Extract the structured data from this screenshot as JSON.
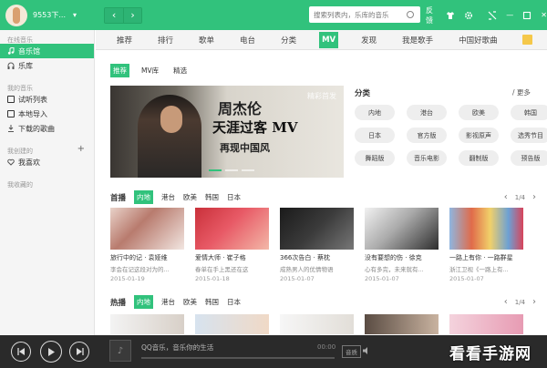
{
  "titlebar": {
    "username": "9553下...",
    "back_label": "‹",
    "forward_label": "›",
    "search_placeholder": "搜索列表内，乐库的音乐",
    "feedback_label": "反馈",
    "minimize_label": "—",
    "close_label": "✕"
  },
  "sidebar": {
    "online_heading": "在线音乐",
    "online_items": [
      {
        "label": "音乐馆"
      },
      {
        "label": "乐库"
      }
    ],
    "mine_heading": "我的音乐",
    "mine_items": [
      {
        "label": "试听列表"
      },
      {
        "label": "本地导入"
      },
      {
        "label": "下载的歌曲"
      }
    ],
    "created_heading": "我创建的",
    "created_add": "+",
    "created_items": [
      {
        "label": "我喜欢"
      }
    ],
    "collected_heading": "我收藏的"
  },
  "topnav": {
    "tabs": [
      {
        "label": "推荐"
      },
      {
        "label": "排行"
      },
      {
        "label": "歌单"
      },
      {
        "label": "电台"
      },
      {
        "label": "分类"
      },
      {
        "label": "MV"
      },
      {
        "label": "发现"
      },
      {
        "label": "我是歌手"
      },
      {
        "label": "中国好歌曲"
      }
    ],
    "active_tab": "MV"
  },
  "subtabs": [
    {
      "label": "推荐"
    },
    {
      "label": "MV库"
    },
    {
      "label": "精选"
    }
  ],
  "banner": {
    "watermark": "精彩首发",
    "line1": "周杰伦",
    "line2": "天涯过客 MV",
    "line3": "再现中国风"
  },
  "categories": {
    "title": "分类",
    "more": "/ 更多",
    "items": [
      "内地",
      "港台",
      "欧美",
      "韩国",
      "日本",
      "官方版",
      "影视原声",
      "选秀节目",
      "舞蹈版",
      "音乐电影",
      "翻制版",
      "预告版"
    ]
  },
  "premiere": {
    "label": "首播",
    "filters": [
      "内地",
      "港台",
      "欧美",
      "韩国",
      "日本"
    ],
    "pager": "1/4",
    "prev": "‹",
    "next": "›",
    "cards": [
      {
        "title": "旅行中的记 · 袁娅维",
        "sub": "李会在记这段对为的...",
        "date": "2015-01-19"
      },
      {
        "title": "爱情大师 · 崔子格",
        "sub": "春单在手上黑还在这",
        "date": "2015-01-18"
      },
      {
        "title": "366次告白 · 蔡枕",
        "sub": "成熟男人的优情物语",
        "date": "2015-01-07"
      },
      {
        "title": "没有要想的伤 · 徐克",
        "sub": "心有多完，未来就有...",
        "date": "2015-01-07"
      },
      {
        "title": "一路上有你 · 一路群星",
        "sub": "浙江卫视《一路上有...",
        "date": "2015-01-07"
      }
    ]
  },
  "hot": {
    "label": "热播",
    "filters": [
      "内地",
      "港台",
      "欧美",
      "韩国",
      "日本"
    ],
    "pager": "1/4",
    "prev": "‹",
    "next": "›"
  },
  "player": {
    "title": "QQ音乐，音乐你的生活",
    "time": "00:00",
    "mode": "音质",
    "progress": 0
  },
  "watermark_site": "看看手游网",
  "colors": {
    "accent": "#31c27c",
    "player_bg": "#2a2a2a"
  }
}
